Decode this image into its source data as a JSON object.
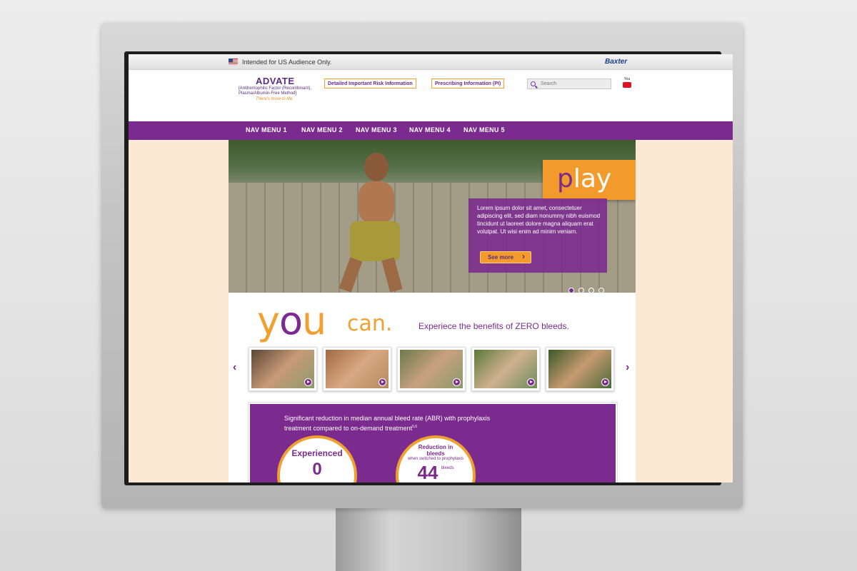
{
  "top_bar": {
    "audience_text": "Intended for US Audience Only.",
    "brand": "Baxter"
  },
  "header": {
    "logo_name": "ADVATE",
    "logo_subtitle": "[Antihemophilic Factor (Recombinant), Plasma/Albumin-Free Method]",
    "logo_tagline": "There's more to life.",
    "risk_link": "Detailed Important Risk Information",
    "pi_link": "Prescribing Information (PI)",
    "search_placeholder": "Search",
    "youtube_label": "You"
  },
  "nav": {
    "items": [
      "NAV MENU 1",
      "NAV MENU 2",
      "NAV MENU 3",
      "NAV MENU 4",
      "NAV MENU 5"
    ]
  },
  "hero": {
    "tab_word_first": "p",
    "tab_word_rest": "lay",
    "promo_text": "Lorem ipsum dolor sit amet, consectetuer adipiscing elit, sed diam nonummy nibh euismod tincidunt ut laoreet dolore magna aliquam erat volutpat. Ut wisi enim ad minim veniam.",
    "button_label": "See more",
    "slide_count": 4,
    "active_slide": 1
  },
  "tagline": {
    "you_y": "y",
    "you_o": "o",
    "you_u": "u",
    "can": "can.",
    "subline": "Experiece the benefits of ZERO bleeds."
  },
  "carousel": {
    "prev_label": "‹",
    "next_label": "›",
    "thumbs": [
      {
        "color": "#7a6a55"
      },
      {
        "color": "#b4865e"
      },
      {
        "color": "#8a9a6a"
      },
      {
        "color": "#6e8c5a"
      },
      {
        "color": "#4a6a3a"
      }
    ]
  },
  "stats": {
    "heading": "Significant reduction in median annual bleed rate (ABR) with prophylaxis treatment compared to on-demand treatment",
    "heading_sup": "5,6",
    "circle1_label": "Experienced",
    "circle1_value": "0",
    "circle2_label": "Reduction in bleeds",
    "circle2_sub": "when switched to prophylaxis",
    "circle2_value": "44",
    "circle2_unit": "bleeds"
  },
  "colors": {
    "purple": "#7b2a8e",
    "orange": "#f39a2c",
    "peach": "#fbe9d4"
  }
}
